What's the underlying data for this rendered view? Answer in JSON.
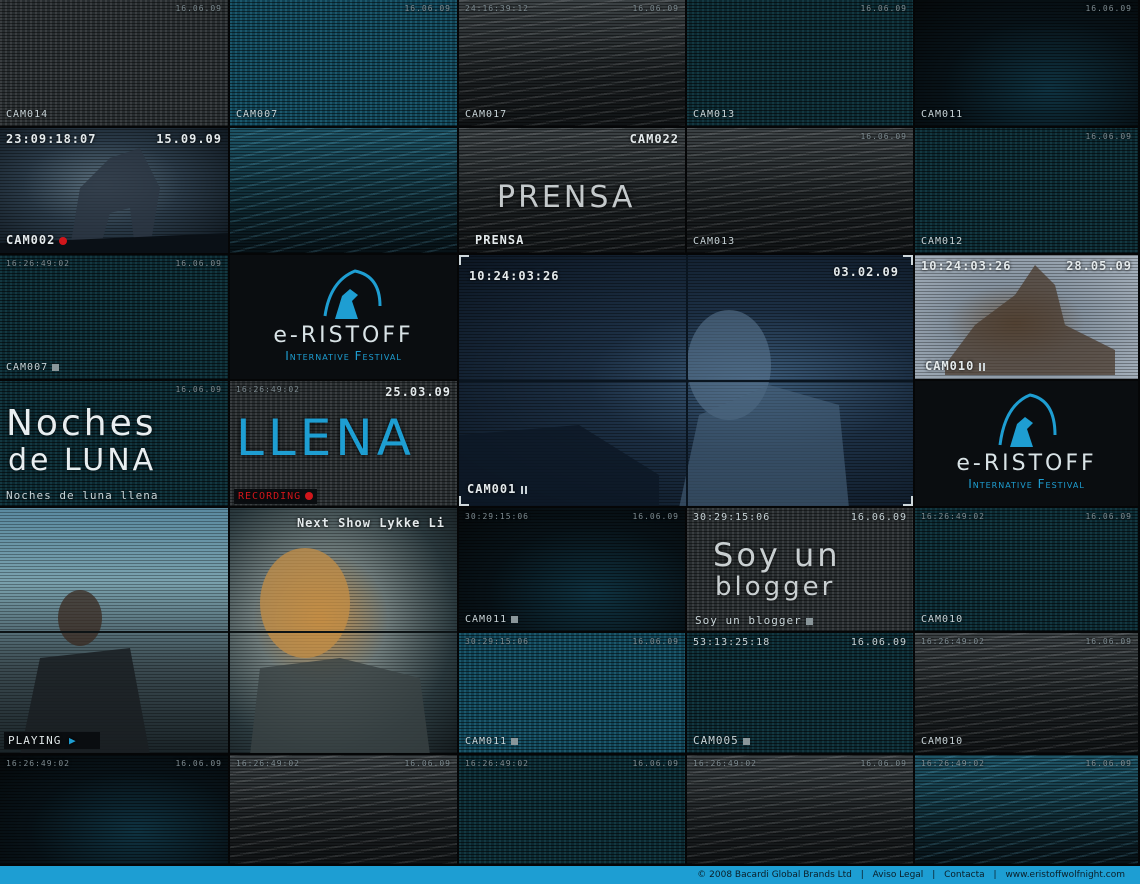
{
  "cells": {
    "r1c1": {
      "cam": "CAM014",
      "date": "16.06.09"
    },
    "r1c2": {
      "cam": "CAM007",
      "date": "16.06.09"
    },
    "r1c3": {
      "cam": "CAM017",
      "time": "24:16:39:12",
      "date": "16.06.09"
    },
    "r1c4": {
      "cam": "CAM013",
      "date": "16.06.09"
    },
    "r1c5": {
      "cam": "CAM011",
      "date": "16.06.09"
    },
    "r2c1": {
      "cam": "CAM002",
      "time": "23:09:18:07",
      "date": "15.09.09"
    },
    "r2c3": {
      "cam": "CAM022",
      "headline": "PRENSA",
      "label": "PRENSA"
    },
    "r2c4": {
      "cam": "CAM013",
      "date": "16.06.09"
    },
    "r2c5": {
      "cam": "CAM012",
      "date": "16.06.09"
    },
    "r3c1": {
      "cam": "CAM007",
      "time": "16:26:49:02",
      "date": "16.06.09"
    },
    "r3c5": {
      "cam": "CAM010",
      "time": "10:24:03:26",
      "date": "28.05.09"
    },
    "main": {
      "cam": "CAM001",
      "time": "10:24:03:26",
      "date": "03.02.09"
    },
    "r4c1": {
      "headline_1": "Noches",
      "headline_2": "de LUNA",
      "label": "Noches de luna llena",
      "date": "16.06.09"
    },
    "r4c2": {
      "headline": "LLENA",
      "status": "RECORDING",
      "time": "16:26:49:02",
      "date": "25.03.09"
    },
    "r5c1": {
      "status": "PLAYING"
    },
    "r5c2": {
      "caption": "Next Show Lykke Li"
    },
    "r5c3": {
      "cam": "CAM011",
      "time": "30:29:15:06",
      "date": "16.06.09"
    },
    "r5c4": {
      "time": "30:29:15:06",
      "date": "16.06.09",
      "headline_1": "Soy un",
      "headline_2": "blogger",
      "label": "Soy un blogger"
    },
    "r5c5": {
      "cam": "CAM010",
      "time": "16:26:49:02",
      "date": "16.06.09"
    },
    "r6c3": {
      "cam": "CAM011",
      "time": "30:29:15:06",
      "date": "16.06.09"
    },
    "r6c4": {
      "cam": "CAM005",
      "time": "53:13:25:18",
      "date": "16.06.09"
    },
    "r6c5": {
      "cam": "CAM010",
      "time": "16:26:49:02",
      "date": "16.06.09"
    },
    "r7c1": {
      "time": "16:26:49:02",
      "date": "16.06.09"
    },
    "r7c2": {
      "time": "16:26:49:02",
      "date": "16.06.09"
    },
    "r7c3": {
      "time": "16:26:49:02",
      "date": "16.06.09"
    },
    "r7c4": {
      "time": "16:26:49:02",
      "date": "16.06.09"
    },
    "r7c5": {
      "time": "16:26:49:02",
      "date": "16.06.09"
    }
  },
  "logo": {
    "brand": "e-RISTOFF",
    "tagline": "Internative Festival"
  },
  "footer": {
    "copyright": "© 2008 Bacardi Global Brands Ltd",
    "legal": "Aviso Legal",
    "contact": "Contacta",
    "sep": "|",
    "url": "www.eristoffwolfnight.com"
  },
  "colors": {
    "accent": "#1d9ed3",
    "record": "#d0161b"
  }
}
